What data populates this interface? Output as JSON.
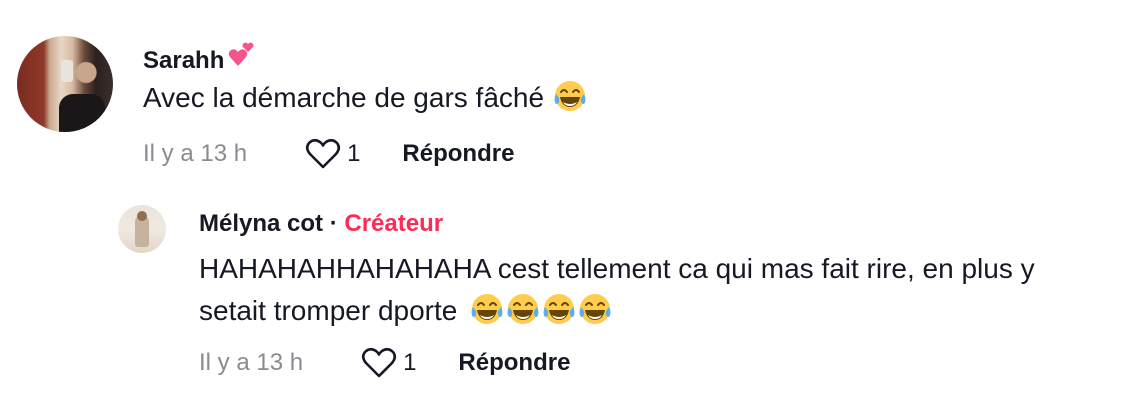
{
  "comments": [
    {
      "username": "Sarahh",
      "username_emoji": "two-hearts-icon",
      "text": "Avec la démarche de gars fâché",
      "text_emojis": [
        "face-with-tears-of-joy-icon"
      ],
      "time": "Il y a 13 h",
      "likes": "1",
      "reply_label": "Répondre"
    },
    {
      "username": "Mélyna cot",
      "separator": "·",
      "badge": "Créateur",
      "text": "HAHAHAHHAHAHAHA cest tellement ca qui mas fait rire, en plus y setait tromper dporte",
      "text_emojis": [
        "face-with-tears-of-joy-icon",
        "face-with-tears-of-joy-icon",
        "face-with-tears-of-joy-icon",
        "face-with-tears-of-joy-icon"
      ],
      "time": "Il y a 13 h",
      "likes": "1",
      "reply_label": "Répondre"
    }
  ],
  "colors": {
    "creator_badge": "#fe2c55",
    "meta_gray": "#8a8b91",
    "text": "#161823"
  }
}
